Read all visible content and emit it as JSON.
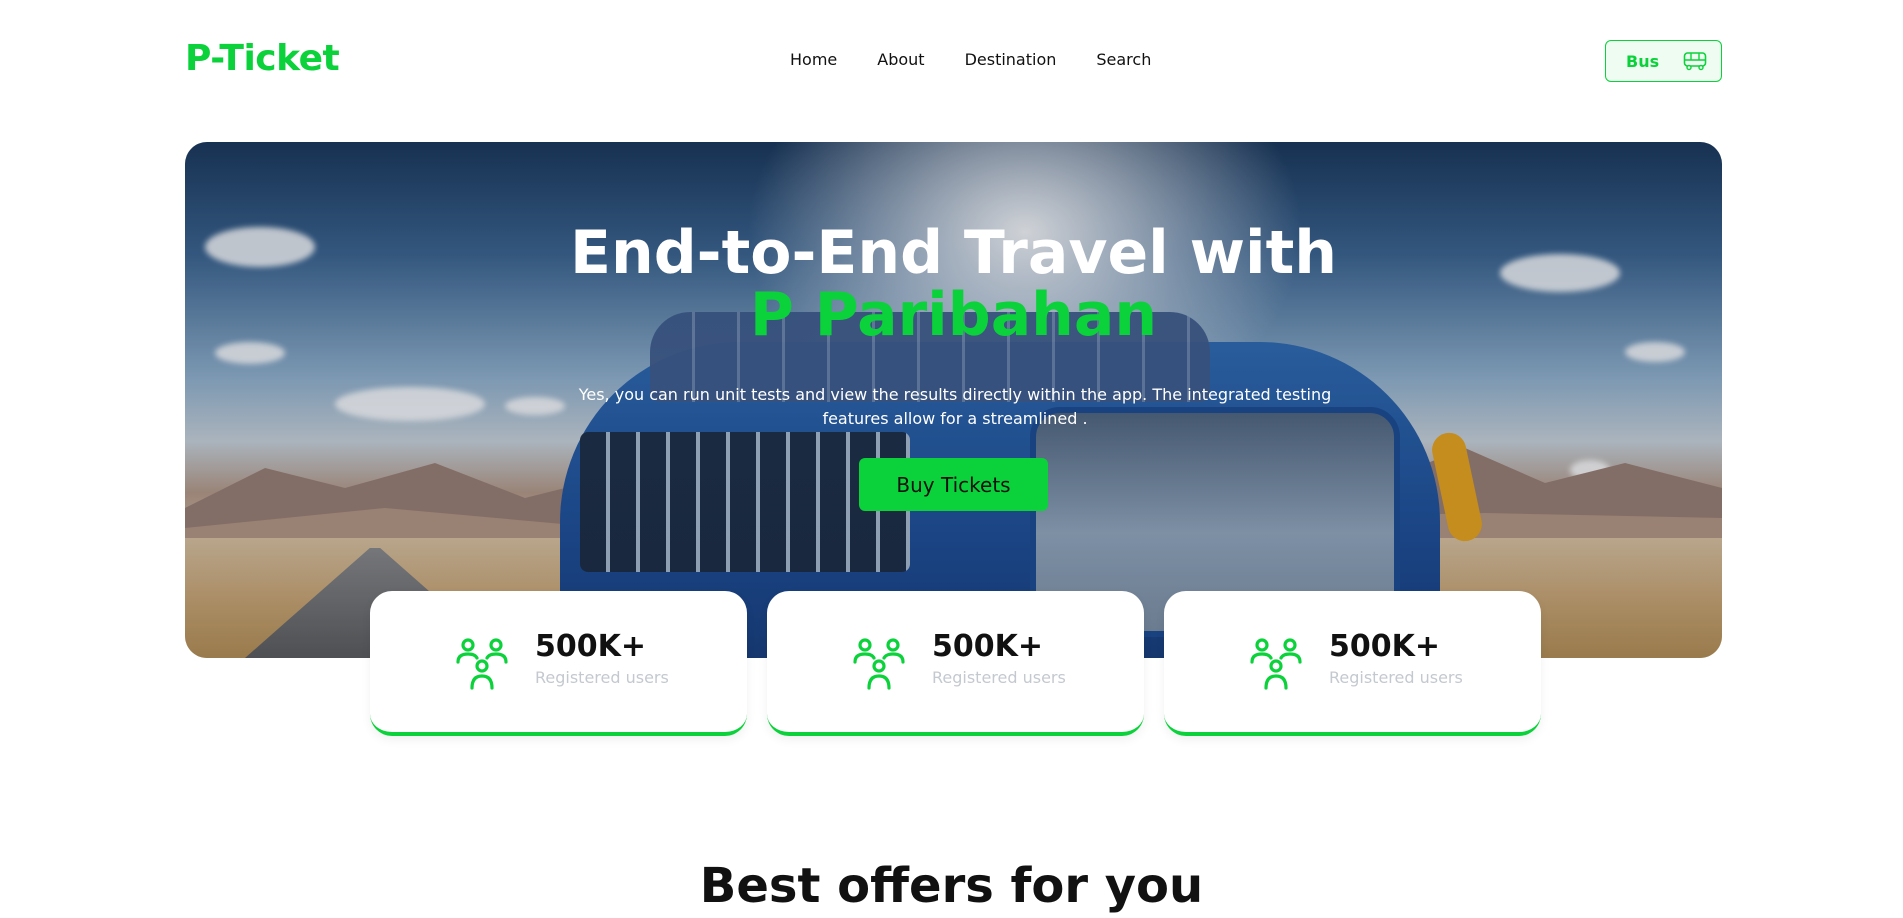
{
  "header": {
    "logo": "P-Ticket",
    "nav": [
      "Home",
      "About",
      "Destination",
      "Search"
    ],
    "bus_button_label": "Bus"
  },
  "hero": {
    "title_line1": "End-to-End Travel with",
    "title_line2": "P Paribahan",
    "subtitle": "Yes, you can run unit tests and view the results directly within the app. The integrated testing features allow for a streamlined .",
    "cta_label": "Buy Tickets"
  },
  "stats": [
    {
      "value": "500K+",
      "label": "Registered users",
      "icon": "users-icon"
    },
    {
      "value": "500K+",
      "label": "Registered users",
      "icon": "users-icon"
    },
    {
      "value": "500K+",
      "label": "Registered users",
      "icon": "users-icon"
    }
  ],
  "offers": {
    "title": "Best offers for you"
  },
  "colors": {
    "accent": "#0bd23a",
    "muted_text": "#c4c9d0",
    "text": "#111111"
  }
}
